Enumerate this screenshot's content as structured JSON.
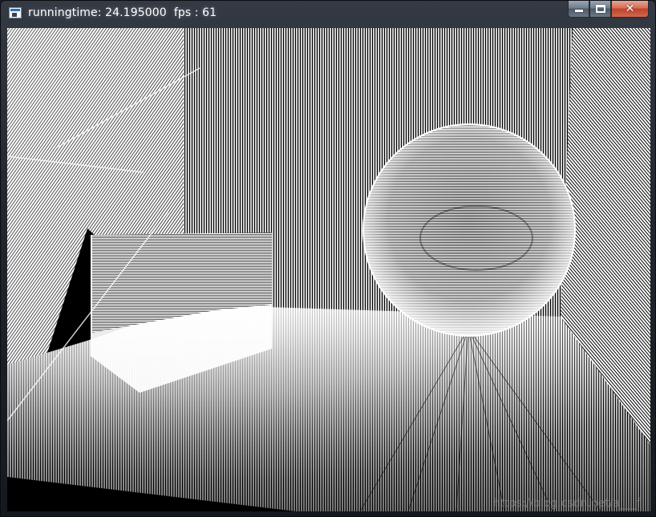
{
  "window": {
    "title": "runningtime: 24.195000  fps : 61",
    "icon": "app-window-icon",
    "buttons": {
      "minimize_icon": "minimize-icon",
      "maximize_icon": "maximize-icon",
      "close_icon": "close-icon",
      "close_glyph": "✕"
    }
  },
  "scene": {
    "description_objects": [
      "floor",
      "back-wall",
      "left-wall",
      "right-wall",
      "box",
      "sphere"
    ],
    "colors": {
      "background": "#000000",
      "line_color": "#ffffff",
      "close_button": "#c7452c"
    }
  },
  "watermark": "https://blog.csdn.net/a___f"
}
